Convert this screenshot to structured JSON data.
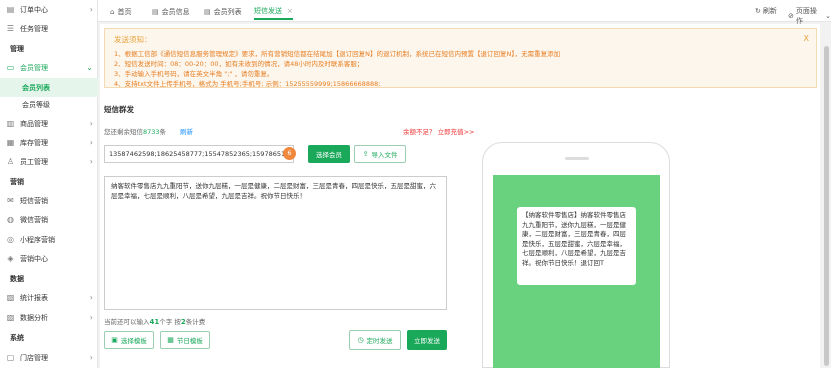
{
  "sidebar": {
    "items": [
      {
        "type": "nav",
        "label": "订单中心",
        "icon": "file-icon",
        "arrow": true
      },
      {
        "type": "nav",
        "label": "任务管理",
        "icon": "list-icon",
        "arrow": false
      },
      {
        "type": "head",
        "label": "管理"
      },
      {
        "type": "nav",
        "label": "会员管理",
        "icon": "member-icon",
        "arrow": true,
        "active": true
      },
      {
        "type": "sub",
        "label": "会员列表",
        "active": true
      },
      {
        "type": "sub",
        "label": "会员等级"
      },
      {
        "type": "nav",
        "label": "商品管理",
        "icon": "goods-icon",
        "arrow": true
      },
      {
        "type": "nav",
        "label": "库存管理",
        "icon": "stock-icon",
        "arrow": true
      },
      {
        "type": "nav",
        "label": "员工管理",
        "icon": "staff-icon",
        "arrow": true
      },
      {
        "type": "head",
        "label": "营销"
      },
      {
        "type": "nav",
        "label": "短信营销",
        "icon": "sms-icon",
        "arrow": false
      },
      {
        "type": "nav",
        "label": "微信营销",
        "icon": "wechat-icon",
        "arrow": false
      },
      {
        "type": "nav",
        "label": "小程序营销",
        "icon": "miniapp-icon",
        "arrow": false
      },
      {
        "type": "nav",
        "label": "营销中心",
        "icon": "marketing-icon",
        "arrow": false
      },
      {
        "type": "head",
        "label": "数据"
      },
      {
        "type": "nav",
        "label": "统计报表",
        "icon": "report-icon",
        "arrow": true
      },
      {
        "type": "nav",
        "label": "数据分析",
        "icon": "analysis-icon",
        "arrow": true
      },
      {
        "type": "head",
        "label": "系统"
      },
      {
        "type": "nav",
        "label": "门店管理",
        "icon": "store-icon",
        "arrow": true
      }
    ]
  },
  "tabs": [
    {
      "label": "首页",
      "icon": "home-icon"
    },
    {
      "label": "会员信息",
      "icon": "doc-icon"
    },
    {
      "label": "会员列表",
      "icon": "doc-icon"
    },
    {
      "label": "短信发送",
      "icon": "",
      "active": true,
      "closable": true
    }
  ],
  "top_actions": {
    "refresh": "刷新",
    "page_ops": "页面操作"
  },
  "notice": {
    "title": "发送须知：",
    "lines": [
      "1、根据工信部《通信短信息服务管理规定》要求，所有营销短信都在结尾加【退订回复N】的退订机制，系统已在短信内预置【退订回复N】，无需重复添加",
      "2、短信发送时间：08：00-20：00，如有未收到的情况，请48小时内及时联系客服；",
      "3、手动输入手机号码，请在英文半角 \";\" ，请勿重复。",
      "4、支持txt文件上传手机号，格式为 手机号;手机号; 示例：15255559999;15866668888;"
    ]
  },
  "section_title": "短信群发",
  "remain": {
    "prefix": "您还剩余短信",
    "count": "8733",
    "suffix": "条",
    "refresh": "刷新"
  },
  "buy_link": "余额不足？ 立即充值>>",
  "phones_value": "13587462598;18625458777;15547852365;15978651",
  "phone_count": "6",
  "buttons": {
    "select_member": "选择会员",
    "import_file": "导入文件",
    "select_template": "选择模板",
    "holiday_template": "节日模板",
    "schedule_send": "定时发送",
    "send_now": "立即发送"
  },
  "message": "纳客软件零售店九九重阳节，送你九层糕，一层是健康，二层是财富，三层是青春，四层是快乐，五层是甜蜜，六层是幸福，七层是顺利，八层是希望，九层是吉祥。祝你节日快乐！",
  "word_count": {
    "prefix": "当前还可以输入",
    "count": "41",
    "mid": "个字",
    "sep": "  按",
    "per": "2",
    "suffix": "条计费"
  },
  "preview": "【纳客软件零售店】纳客软件零售店九九重阳节，送你九层糕，一层是健康，二层是财富，三层是青春，四层是快乐，五层是甜蜜，六层是幸福，七层是顺利，八层是希望，九层是吉祥。祝你节日快乐！退订回T",
  "colors": {
    "accent": "#1aa85a",
    "notice_text": "#e67e22",
    "phone_screen": "#68d27e",
    "link": "#1890ff",
    "warning": "#e33"
  }
}
